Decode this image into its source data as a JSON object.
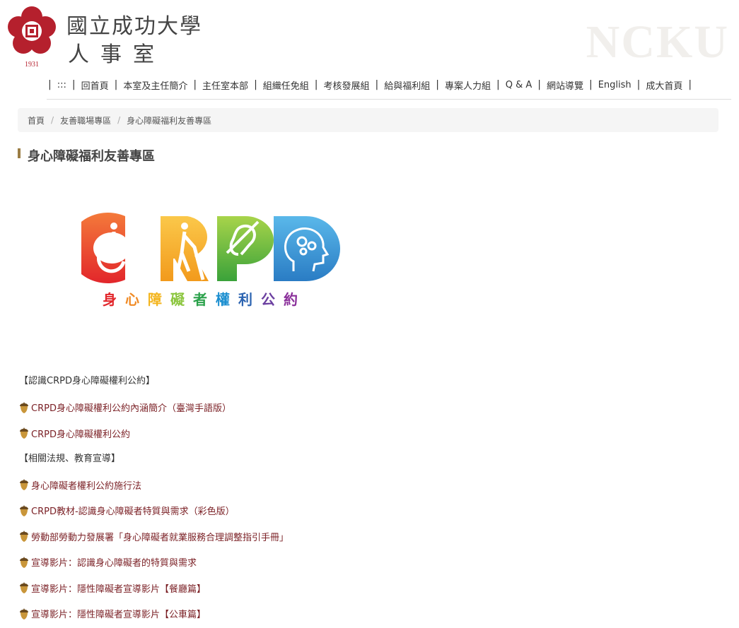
{
  "header": {
    "logo_year": "1931",
    "university_name": "國立成功大學",
    "office_name": "人事室",
    "watermark": "NCKU"
  },
  "nav": {
    "items": [
      {
        "label": ":::"
      },
      {
        "label": "回首頁"
      },
      {
        "label": "本室及主任簡介"
      },
      {
        "label": "主任室本部"
      },
      {
        "label": "組織任免組"
      },
      {
        "label": "考核發展組"
      },
      {
        "label": "給與福利組"
      },
      {
        "label": "專案人力組"
      },
      {
        "label": "Q & A"
      },
      {
        "label": "網站導覽"
      },
      {
        "label": "English"
      },
      {
        "label": "成大首頁"
      }
    ],
    "separator": "|"
  },
  "breadcrumb": {
    "items": [
      "首頁",
      "友善職場專區",
      "身心障礙福利友善專區"
    ],
    "separator": "/"
  },
  "page_title": "身心障礙福利友善專區",
  "crpd_logo": {
    "letters": [
      "C",
      "R",
      "P",
      "D"
    ],
    "caption_chars": [
      "身",
      "心",
      "障",
      "礙",
      "者",
      "權",
      "利",
      "公",
      "約"
    ],
    "caption_colors": [
      "#e2262b",
      "#f08a24",
      "#f3b41c",
      "#8cc63f",
      "#2aa14a",
      "#1c8fd0",
      "#2c64b1",
      "#6b3fa0",
      "#8a2f9a"
    ],
    "colors": {
      "c": "#e8482a",
      "r": "#f6a623",
      "p": "#7cbf2a",
      "d": "#2a92d2"
    }
  },
  "content": {
    "section1": "【認識CRPD身心障礙權利公約】",
    "links1": [
      "CRPD身心障礙權利公約內涵簡介（臺灣手語版）",
      "CRPD身心障礙權利公約"
    ],
    "section2": "【相關法規、教育宣導】",
    "links2": [
      "身心障礙者權利公約施行法",
      "CRPD教材-認識身心障礙者特質與需求（彩色版）",
      "勞動部勞動力發展署「身心障礙者就業服務合理調整指引手冊」",
      "宣導影片：認識身心障礙者的特質與需求",
      "宣導影片：隱性障礙者宣導影片【餐廳篇】",
      "宣導影片：隱性障礙者宣導影片【公車篇】"
    ]
  },
  "colors": {
    "brand_red": "#b5202d",
    "link": "#7a1f24",
    "title_accent": "#9b7d45"
  }
}
